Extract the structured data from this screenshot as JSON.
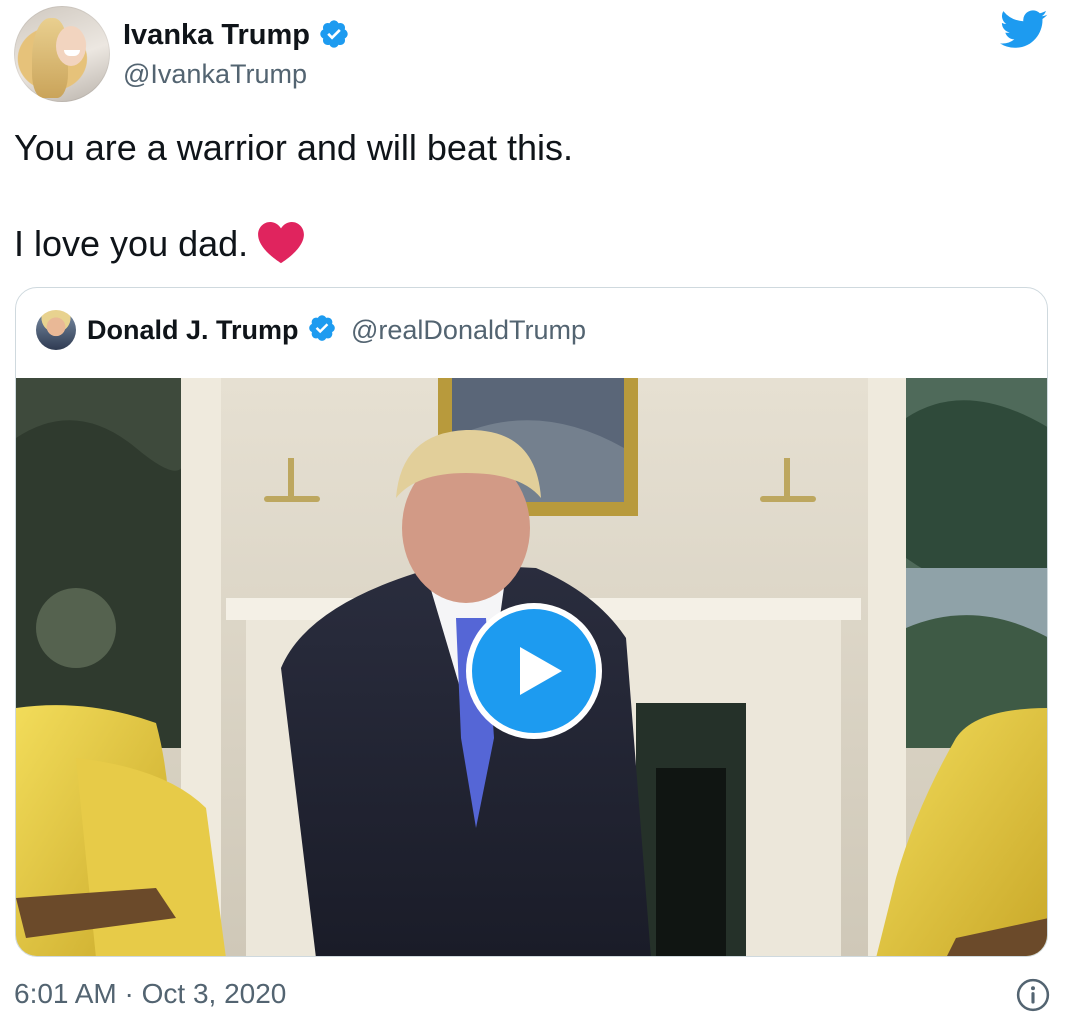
{
  "author": {
    "name": "Ivanka Trump",
    "handle": "@IvankaTrump"
  },
  "tweet": {
    "line1": "You are a warrior and will beat this.",
    "line2": "I love you dad.",
    "emoji": "heart-icon"
  },
  "quoted": {
    "name": "Donald J. Trump",
    "handle": "@realDonaldTrump",
    "media_type": "video",
    "play_icon": "play-icon"
  },
  "footer": {
    "timestamp": "6:01 AM · Oct 3, 2020",
    "info_icon": "info-icon"
  },
  "icons": {
    "brand": "twitter-bird-icon",
    "verified": "verified-badge-icon"
  },
  "colors": {
    "accent": "#1d9bf0",
    "text": "#0f1419",
    "secondary": "#536471",
    "heart": "#e0245e",
    "border": "#cfd9de"
  }
}
